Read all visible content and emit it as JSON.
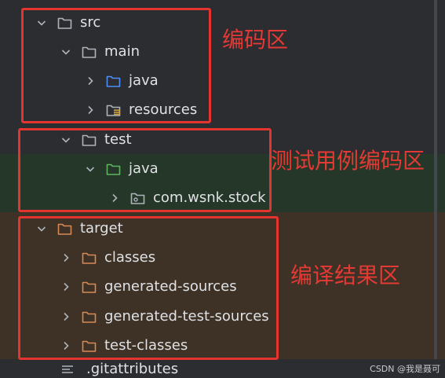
{
  "project_tree": {
    "nodes": [
      {
        "label": "src",
        "expanded": true,
        "folder_icon": "folder-icon",
        "folder_color": "#aeb3bb"
      },
      {
        "label": "main",
        "expanded": true,
        "folder_icon": "folder-icon",
        "folder_color": "#aeb3bb"
      },
      {
        "label": "java",
        "expanded": false,
        "folder_icon": "source-folder-icon",
        "folder_color": "#4f8ef7"
      },
      {
        "label": "resources",
        "expanded": false,
        "folder_icon": "resources-folder-icon",
        "folder_color": "#aeb3bb"
      },
      {
        "label": "test",
        "expanded": true,
        "folder_icon": "folder-icon",
        "folder_color": "#aeb3bb"
      },
      {
        "label": "java",
        "expanded": true,
        "folder_icon": "test-source-folder-icon",
        "folder_color": "#5fb360"
      },
      {
        "label": "com.wsnk.stock",
        "expanded": false,
        "folder_icon": "package-icon",
        "folder_color": "#aeb3bb"
      },
      {
        "label": "target",
        "expanded": true,
        "folder_icon": "excluded-folder-icon",
        "folder_color": "#d78955"
      },
      {
        "label": "classes",
        "expanded": false,
        "folder_icon": "excluded-folder-icon",
        "folder_color": "#d78955"
      },
      {
        "label": "generated-sources",
        "expanded": false,
        "folder_icon": "excluded-folder-icon",
        "folder_color": "#d78955"
      },
      {
        "label": "generated-test-sources",
        "expanded": false,
        "folder_icon": "excluded-folder-icon",
        "folder_color": "#d78955"
      },
      {
        "label": "test-classes",
        "expanded": false,
        "folder_icon": "excluded-folder-icon",
        "folder_color": "#d78955"
      }
    ],
    "partial_file": {
      "label": ".gitattributes",
      "icon": "text-file-icon"
    }
  },
  "annotations": {
    "coding_area": "编码区",
    "test_coding_area": "测试用例编码区",
    "build_output_area": "编译结果区"
  },
  "watermark": "CSDN @我是聂可",
  "colors": {
    "background": "#2b2d30",
    "test_band": "#253728",
    "target_band": "#3d3225",
    "annotation_red": "#e53935"
  }
}
